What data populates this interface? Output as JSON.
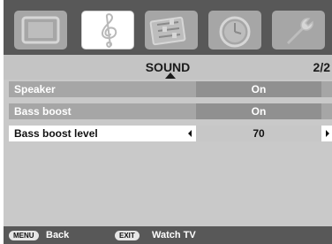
{
  "header": {
    "title": "SOUND",
    "page": "2/2"
  },
  "tabs": [
    {
      "icon": "tv-icon",
      "active": false
    },
    {
      "icon": "music-clef-icon",
      "active": true
    },
    {
      "icon": "equalizer-icon",
      "active": false
    },
    {
      "icon": "clock-icon",
      "active": false
    },
    {
      "icon": "wrench-icon",
      "active": false
    }
  ],
  "rows": [
    {
      "label": "Speaker",
      "value": "On"
    },
    {
      "label": "Bass boost",
      "value": "On"
    },
    {
      "label": "Bass boost level",
      "value": "70",
      "selected": true
    }
  ],
  "footer": {
    "menu_key": "MENU",
    "menu_action": "Back",
    "exit_key": "EXIT",
    "exit_action": "Watch TV"
  },
  "colors": {
    "panel": "#c9c9c9",
    "bar": "#585858",
    "row": "#a6a6a6",
    "value": "#909090",
    "selected": "#ffffff"
  }
}
